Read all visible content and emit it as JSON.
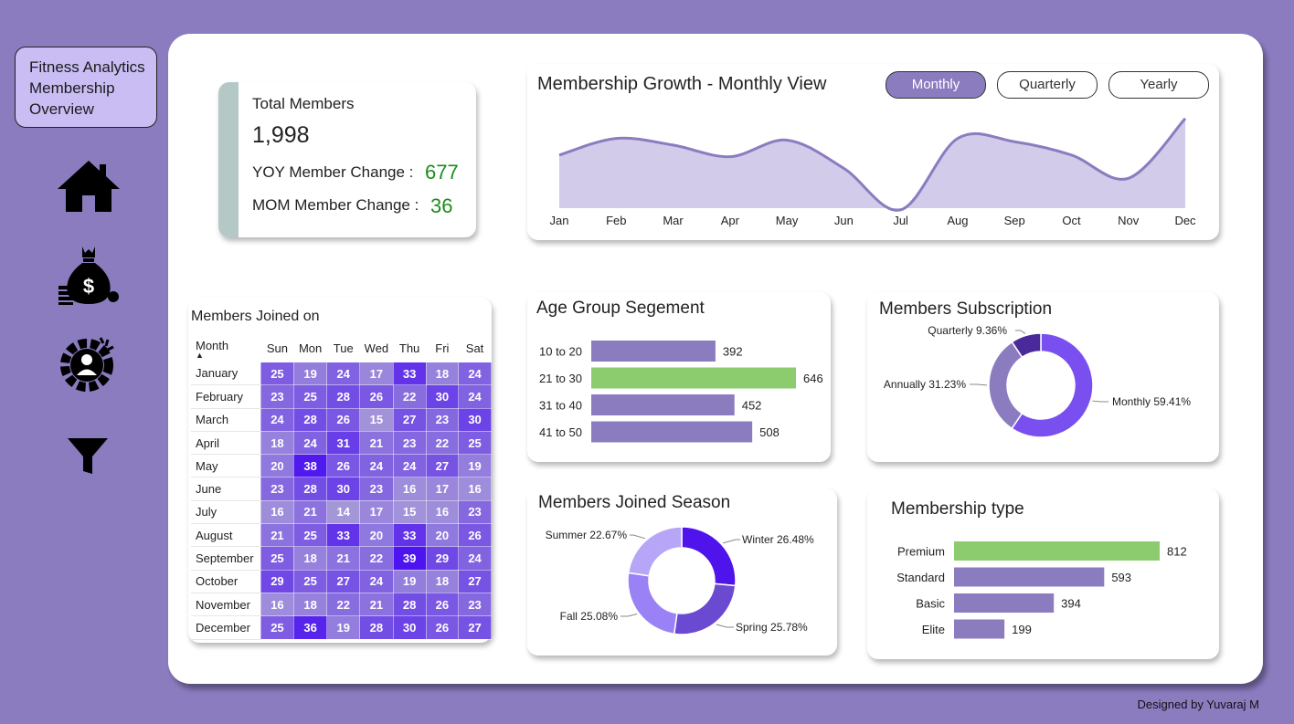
{
  "sidebar": {
    "title_line1": "Fitness Analytics",
    "title_line2": "Membership",
    "title_line3": "Overview",
    "nav": [
      {
        "icon": "home-icon"
      },
      {
        "icon": "money-bag-icon"
      },
      {
        "icon": "user-gear-icon"
      },
      {
        "icon": "filter-icon"
      }
    ]
  },
  "kpi": {
    "total_label": "Total Members",
    "total_value": "1,998",
    "yoy_label": "YOY Member Change :",
    "yoy_value": "677",
    "mom_label": "MOM Member Change :",
    "mom_value": "36"
  },
  "growth": {
    "title": "Membership Growth - Monthly View",
    "toggles": [
      "Monthly",
      "Quarterly",
      "Yearly"
    ],
    "active_toggle": "Monthly"
  },
  "heatmap": {
    "title": "Members Joined on",
    "month_header": "Month",
    "days": [
      "Sun",
      "Mon",
      "Tue",
      "Wed",
      "Thu",
      "Fri",
      "Sat"
    ],
    "rows": [
      {
        "month": "January",
        "values": [
          25,
          19,
          24,
          17,
          33,
          18,
          24
        ]
      },
      {
        "month": "February",
        "values": [
          23,
          25,
          28,
          26,
          22,
          30,
          24
        ]
      },
      {
        "month": "March",
        "values": [
          24,
          28,
          26,
          15,
          27,
          23,
          30
        ]
      },
      {
        "month": "April",
        "values": [
          18,
          24,
          31,
          21,
          23,
          22,
          25
        ]
      },
      {
        "month": "May",
        "values": [
          20,
          38,
          26,
          24,
          24,
          27,
          19
        ]
      },
      {
        "month": "June",
        "values": [
          23,
          28,
          30,
          23,
          16,
          17,
          16
        ]
      },
      {
        "month": "July",
        "values": [
          16,
          21,
          14,
          17,
          15,
          16,
          23
        ]
      },
      {
        "month": "August",
        "values": [
          21,
          25,
          33,
          20,
          33,
          20,
          26
        ]
      },
      {
        "month": "September",
        "values": [
          25,
          18,
          21,
          22,
          39,
          29,
          24
        ]
      },
      {
        "month": "October",
        "values": [
          29,
          25,
          27,
          24,
          19,
          18,
          27
        ]
      },
      {
        "month": "November",
        "values": [
          16,
          18,
          22,
          21,
          28,
          26,
          23
        ]
      },
      {
        "month": "December",
        "values": [
          25,
          36,
          19,
          28,
          30,
          26,
          27
        ]
      }
    ]
  },
  "colors": {
    "bar": "#8b7cc0",
    "highlight": "#8ccc6e",
    "heat_low": "#a497d8",
    "heat_high": "#4d14ef",
    "area_fill": "#d2cbea",
    "area_line": "#8b7cc0",
    "kpi_green": "#1d8b1d"
  },
  "credit": "Designed by Yuvaraj M",
  "chart_data": [
    {
      "type": "area",
      "title": "Membership Growth - Monthly View",
      "categories": [
        "Jan",
        "Feb",
        "Mar",
        "Apr",
        "May",
        "Jun",
        "Jul",
        "Aug",
        "Sep",
        "Oct",
        "Nov",
        "Dec"
      ],
      "values": [
        172,
        182,
        178,
        171,
        181,
        164,
        139,
        182,
        180,
        172,
        158,
        194
      ],
      "ylim": [
        140,
        195
      ],
      "grid": false
    },
    {
      "type": "bar",
      "orientation": "horizontal",
      "title": "Age Group Segement",
      "categories": [
        "10 to 20",
        "21 to 30",
        "31 to 40",
        "41 to 50"
      ],
      "values": [
        392,
        646,
        452,
        508
      ],
      "highlight_index": 1
    },
    {
      "type": "pie",
      "donut": true,
      "title": "Members Subscription",
      "slices": [
        {
          "label": "Monthly",
          "pct": "59.41%",
          "value": 59.41,
          "color": "#7a4ff0"
        },
        {
          "label": "Annually",
          "pct": "31.23%",
          "value": 31.23,
          "color": "#8b7cc0"
        },
        {
          "label": "Quarterly",
          "pct": "9.36%",
          "value": 9.36,
          "color": "#4a2a9b"
        }
      ]
    },
    {
      "type": "pie",
      "donut": true,
      "title": "Members Joined Season",
      "slices": [
        {
          "label": "Winter",
          "pct": "26.48%",
          "value": 26.48,
          "color": "#4f14ec"
        },
        {
          "label": "Spring",
          "pct": "25.78%",
          "value": 25.78,
          "color": "#6a4ad0"
        },
        {
          "label": "Fall",
          "pct": "25.08%",
          "value": 25.08,
          "color": "#9a81f5"
        },
        {
          "label": "Summer",
          "pct": "22.67%",
          "value": 22.67,
          "color": "#b7a5f7"
        }
      ]
    },
    {
      "type": "bar",
      "orientation": "horizontal",
      "title": "Membership type",
      "categories": [
        "Premium",
        "Standard",
        "Basic",
        "Elite"
      ],
      "values": [
        812,
        593,
        394,
        199
      ],
      "highlight_index": 0
    }
  ]
}
